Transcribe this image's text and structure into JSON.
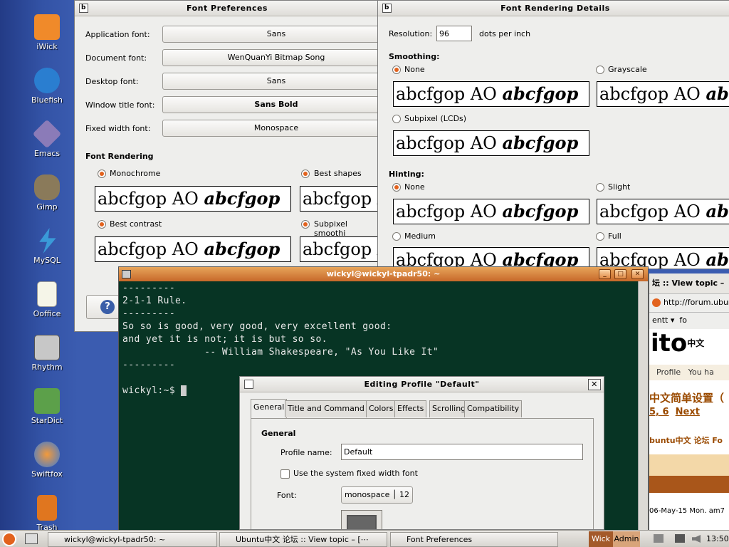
{
  "desktop": {
    "icons": [
      {
        "label": "iWick",
        "color": "#f08a2a"
      },
      {
        "label": "Bluefish",
        "color": "#2a7ed0"
      },
      {
        "label": "Emacs",
        "color": "#8b7bb8"
      },
      {
        "label": "Gimp",
        "color": "#8a7a5a"
      },
      {
        "label": "MySQL",
        "color": "#3a9ad8"
      },
      {
        "label": "Ooffice",
        "color": "#f5f5e8"
      },
      {
        "label": "Rhythm",
        "color": "#c7c7c7"
      },
      {
        "label": "StarDict",
        "color": "#5ca04a"
      },
      {
        "label": "Swiftfox",
        "color": "#3a7ad8"
      },
      {
        "label": "Trash",
        "color": "#e0761f"
      }
    ]
  },
  "font_prefs": {
    "title": "Font Preferences",
    "app_label": "Application font:",
    "app_value": "Sans",
    "doc_label": "Document font:",
    "doc_value": "WenQuanYi Bitmap Song",
    "desk_label": "Desktop font:",
    "desk_value": "Sans",
    "wtitle_label": "Window title font:",
    "wtitle_value": "Sans Bold",
    "fixed_label": "Fixed width font:",
    "fixed_value": "Monospace",
    "rendering_heading": "Font Rendering",
    "mono": "Monochrome",
    "best_shapes": "Best shapes",
    "best_contrast": "Best contrast",
    "subpixel": "Subpixel smoothi",
    "sample_plain": "abcfgop AO ",
    "sample_bold": "abcfgop",
    "help": "?"
  },
  "details": {
    "title": "Font Rendering Details",
    "resolution_label": "Resolution:",
    "resolution_value": "96",
    "dpi": "dots per inch",
    "smoothing": "Smoothing:",
    "none": "None",
    "grayscale": "Grayscale",
    "subpixel": "Subpixel (LCDs)",
    "hinting": "Hinting:",
    "slight": "Slight",
    "medium": "Medium",
    "full": "Full"
  },
  "terminal": {
    "title": "wickyl@wickyl-tpadr50: ~",
    "lines": [
      "---------",
      "2-1-1 Rule.",
      "---------",
      "So so is good, very good, very excellent good:",
      "and yet it is not; it is but so so.",
      "              -- William Shakespeare, \"As You Like It\"",
      "---------",
      "",
      "wickyl:~$ "
    ],
    "min": "_",
    "max": "□",
    "close": "✕"
  },
  "profile": {
    "title": "Editing Profile \"Default\"",
    "tabs": [
      "General",
      "Title and Command",
      "Colors",
      "Effects",
      "Scrolling",
      "Compatibility"
    ],
    "section": "General",
    "name_label": "Profile name:",
    "name_value": "Default",
    "fixed_font_label": "Use the system fixed width font",
    "font_label": "Font:",
    "font_value": "monospace",
    "font_size": "12",
    "close": "✕"
  },
  "firefox": {
    "title": "坛 :: View topic –",
    "url": "http://forum.ubun",
    "bm1": "entt",
    "bm2": "fo",
    "logo": "ito",
    "cn": "中文",
    "profile": "Profile",
    "you": "You ha",
    "heading": "中文简单设置（",
    "pages": "5, 6",
    "next": "Next",
    "forum": "buntu中文 论坛 Fo",
    "date": "06-May-15 Mon. am7"
  },
  "panel": {
    "tasks": [
      "wickyl@wickyl-tpadr50: ~",
      "Ubuntu中文 论坛 :: View topic – [⋯",
      "Font Preferences"
    ],
    "ws1": "Wick",
    "ws2": "Admin",
    "clock": "13:50"
  }
}
